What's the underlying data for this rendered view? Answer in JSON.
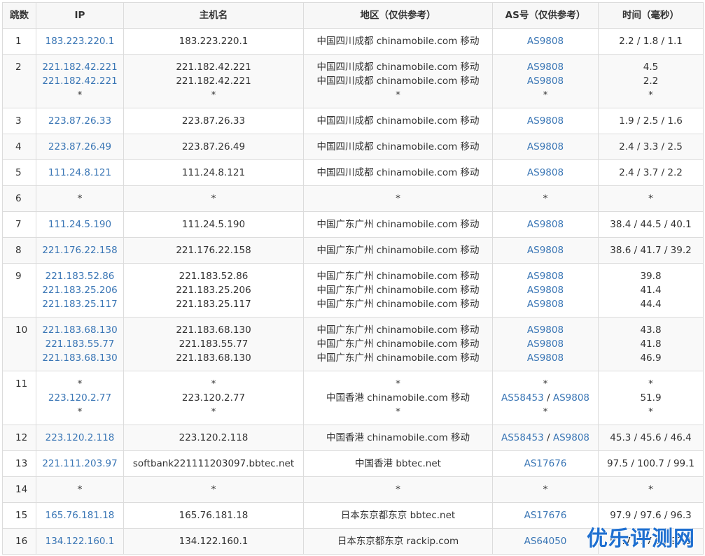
{
  "headers": [
    "跳数",
    "IP",
    "主机名",
    "地区（仅供参考）",
    "AS号（仅供参考）",
    "时间（毫秒）"
  ],
  "rows": [
    {
      "hop": "1",
      "ip": [
        "183.223.220.1"
      ],
      "host": [
        "183.223.220.1"
      ],
      "region": [
        "中国四川成都 chinamobile.com 移动"
      ],
      "as": [
        [
          "AS9808"
        ]
      ],
      "time": [
        "2.2 / 1.8 / 1.1"
      ]
    },
    {
      "hop": "2",
      "ip": [
        "221.182.42.221",
        "221.182.42.221",
        "*"
      ],
      "host": [
        "221.182.42.221",
        "221.182.42.221",
        "*"
      ],
      "region": [
        "中国四川成都 chinamobile.com 移动",
        "中国四川成都 chinamobile.com 移动",
        "*"
      ],
      "as": [
        [
          "AS9808"
        ],
        [
          "AS9808"
        ],
        [
          "*"
        ]
      ],
      "time": [
        "4.5",
        "2.2",
        "*"
      ]
    },
    {
      "hop": "3",
      "ip": [
        "223.87.26.33"
      ],
      "host": [
        "223.87.26.33"
      ],
      "region": [
        "中国四川成都 chinamobile.com 移动"
      ],
      "as": [
        [
          "AS9808"
        ]
      ],
      "time": [
        "1.9 / 2.5 / 1.6"
      ]
    },
    {
      "hop": "4",
      "ip": [
        "223.87.26.49"
      ],
      "host": [
        "223.87.26.49"
      ],
      "region": [
        "中国四川成都 chinamobile.com 移动"
      ],
      "as": [
        [
          "AS9808"
        ]
      ],
      "time": [
        "2.4 / 3.3 / 2.5"
      ]
    },
    {
      "hop": "5",
      "ip": [
        "111.24.8.121"
      ],
      "host": [
        "111.24.8.121"
      ],
      "region": [
        "中国四川成都 chinamobile.com 移动"
      ],
      "as": [
        [
          "AS9808"
        ]
      ],
      "time": [
        "2.4 / 3.7 / 2.2"
      ]
    },
    {
      "hop": "6",
      "ip": [
        "*"
      ],
      "host": [
        "*"
      ],
      "region": [
        "*"
      ],
      "as": [
        [
          "*"
        ]
      ],
      "time": [
        "*"
      ]
    },
    {
      "hop": "7",
      "ip": [
        "111.24.5.190"
      ],
      "host": [
        "111.24.5.190"
      ],
      "region": [
        "中国广东广州 chinamobile.com 移动"
      ],
      "as": [
        [
          "AS9808"
        ]
      ],
      "time": [
        "38.4 / 44.5 / 40.1"
      ]
    },
    {
      "hop": "8",
      "ip": [
        "221.176.22.158"
      ],
      "host": [
        "221.176.22.158"
      ],
      "region": [
        "中国广东广州 chinamobile.com 移动"
      ],
      "as": [
        [
          "AS9808"
        ]
      ],
      "time": [
        "38.6 / 41.7 / 39.2"
      ]
    },
    {
      "hop": "9",
      "ip": [
        "221.183.52.86",
        "221.183.25.206",
        "221.183.25.117"
      ],
      "host": [
        "221.183.52.86",
        "221.183.25.206",
        "221.183.25.117"
      ],
      "region": [
        "中国广东广州 chinamobile.com 移动",
        "中国广东广州 chinamobile.com 移动",
        "中国广东广州 chinamobile.com 移动"
      ],
      "as": [
        [
          "AS9808"
        ],
        [
          "AS9808"
        ],
        [
          "AS9808"
        ]
      ],
      "time": [
        "39.8",
        "41.4",
        "44.4"
      ]
    },
    {
      "hop": "10",
      "ip": [
        "221.183.68.130",
        "221.183.55.77",
        "221.183.68.130"
      ],
      "host": [
        "221.183.68.130",
        "221.183.55.77",
        "221.183.68.130"
      ],
      "region": [
        "中国广东广州 chinamobile.com 移动",
        "中国广东广州 chinamobile.com 移动",
        "中国广东广州 chinamobile.com 移动"
      ],
      "as": [
        [
          "AS9808"
        ],
        [
          "AS9808"
        ],
        [
          "AS9808"
        ]
      ],
      "time": [
        "43.8",
        "41.8",
        "46.9"
      ]
    },
    {
      "hop": "11",
      "ip": [
        "*",
        "223.120.2.77",
        "*"
      ],
      "host": [
        "*",
        "223.120.2.77",
        "*"
      ],
      "region": [
        "*",
        "中国香港 chinamobile.com 移动",
        "*"
      ],
      "as": [
        [
          "*"
        ],
        [
          "AS58453",
          "AS9808"
        ],
        [
          "*"
        ]
      ],
      "time": [
        "*",
        "51.9",
        "*"
      ]
    },
    {
      "hop": "12",
      "ip": [
        "223.120.2.118"
      ],
      "host": [
        "223.120.2.118"
      ],
      "region": [
        "中国香港 chinamobile.com 移动"
      ],
      "as": [
        [
          "AS58453",
          "AS9808"
        ]
      ],
      "time": [
        "45.3 / 45.6 / 46.4"
      ]
    },
    {
      "hop": "13",
      "ip": [
        "221.111.203.97"
      ],
      "host": [
        "softbank221111203097.bbtec.net"
      ],
      "region": [
        "中国香港 bbtec.net"
      ],
      "as": [
        [
          "AS17676"
        ]
      ],
      "time": [
        "97.5 / 100.7 / 99.1"
      ]
    },
    {
      "hop": "14",
      "ip": [
        "*"
      ],
      "host": [
        "*"
      ],
      "region": [
        "*"
      ],
      "as": [
        [
          "*"
        ]
      ],
      "time": [
        "*"
      ]
    },
    {
      "hop": "15",
      "ip": [
        "165.76.181.18"
      ],
      "host": [
        "165.76.181.18"
      ],
      "region": [
        "日本东京都东京 bbtec.net"
      ],
      "as": [
        [
          "AS17676"
        ]
      ],
      "time": [
        "97.9 / 97.6 / 96.3"
      ]
    },
    {
      "hop": "16",
      "ip": [
        "134.122.160.1"
      ],
      "host": [
        "134.122.160.1"
      ],
      "region": [
        "日本东京都东京 rackip.com"
      ],
      "as": [
        [
          "AS64050"
        ]
      ],
      "time": [
        "97.7 / 97.8 / 97.8"
      ]
    }
  ],
  "watermark": "优乐评测网",
  "colors": {
    "link": "#3a76b5",
    "border": "#dcdcdc",
    "header_bg": "#f7f7f7",
    "watermark": "#1e6fd0"
  }
}
